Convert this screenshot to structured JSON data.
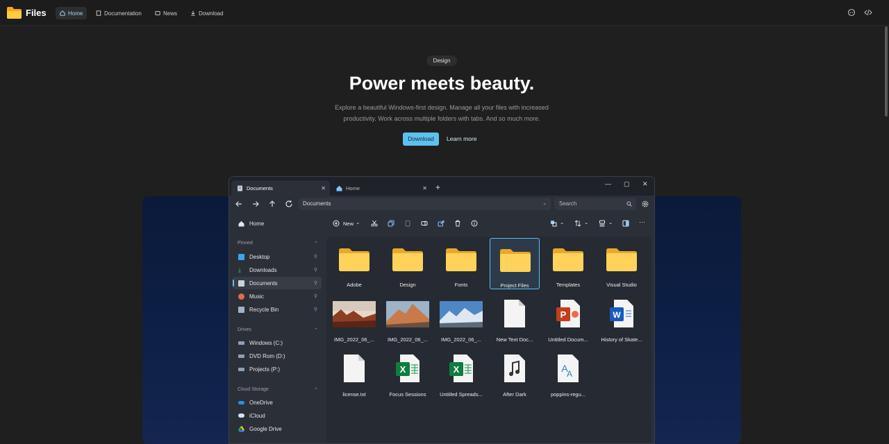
{
  "brand": "Files",
  "nav": [
    {
      "label": "Home",
      "icon": "home-icon",
      "active": true
    },
    {
      "label": "Documentation",
      "icon": "book-icon"
    },
    {
      "label": "News",
      "icon": "news-icon"
    },
    {
      "label": "Download",
      "icon": "download-icon"
    }
  ],
  "hero": {
    "pill": "Design",
    "title": "Power meets beauty.",
    "desc_line1": "Explore a beautiful Windows-first design. Manage all your files with increased",
    "desc_line2": "productivity. Work across multiple folders with tabs. And so much more.",
    "download": "Download",
    "learn_more": "Learn more"
  },
  "window": {
    "tabs": [
      {
        "label": "Documents",
        "active": true
      },
      {
        "label": "Home"
      }
    ],
    "address": "Documents",
    "search_placeholder": "Search",
    "new_label": "New",
    "sidebar": {
      "home": "Home",
      "pinned_header": "Pinned",
      "pinned": [
        "Desktop",
        "Downloads",
        "Documents",
        "Music",
        "Recycle Bin"
      ],
      "drives_header": "Drives",
      "drives": [
        "Windows (C:)",
        "DVD Rom (D:)",
        "Projects (P:)"
      ],
      "cloud_header": "Cloud Storage",
      "cloud": [
        "OneDrive",
        "iCloud",
        "Google Drive"
      ]
    },
    "files": [
      {
        "label": "Adobe",
        "kind": "folder"
      },
      {
        "label": "Design",
        "kind": "folder"
      },
      {
        "label": "Fonts",
        "kind": "folder"
      },
      {
        "label": "Project Files",
        "kind": "folder",
        "selected": true
      },
      {
        "label": "Templates",
        "kind": "folder"
      },
      {
        "label": "Visual Studio",
        "kind": "folder"
      },
      {
        "label": "IMG_2022_06_...",
        "kind": "image-desert"
      },
      {
        "label": "IMG_2022_06_...",
        "kind": "image-mountain"
      },
      {
        "label": "IMG_2022_06_...",
        "kind": "image-snow"
      },
      {
        "label": "New Text Doc...",
        "kind": "text"
      },
      {
        "label": "Untitled Docum...",
        "kind": "powerpoint"
      },
      {
        "label": "History of Skate...",
        "kind": "word"
      },
      {
        "label": "license.txt",
        "kind": "text"
      },
      {
        "label": "Focus Sessions",
        "kind": "excel"
      },
      {
        "label": "Untitled Spreads...",
        "kind": "excel"
      },
      {
        "label": "After Dark",
        "kind": "music"
      },
      {
        "label": "poppins-regu...",
        "kind": "font"
      }
    ]
  },
  "colors": {
    "accent": "#5fc0ee",
    "folder": "#f5c44c",
    "background": "#1f1f1f"
  }
}
